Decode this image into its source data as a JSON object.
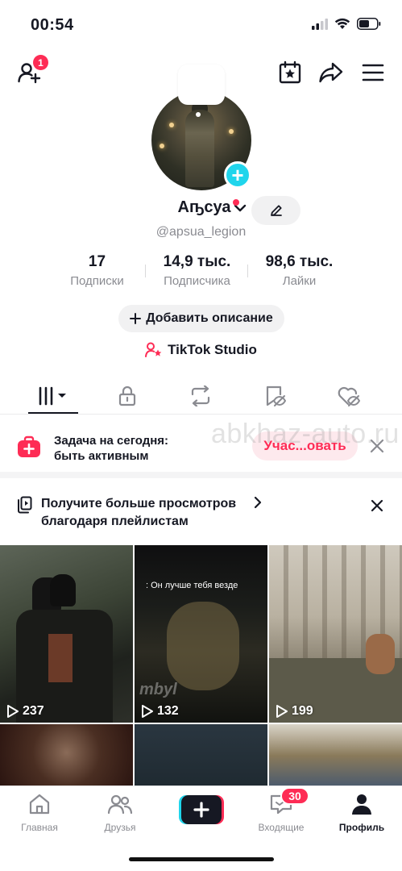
{
  "status_bar": {
    "time": "00:54"
  },
  "header": {
    "notification_count": "1"
  },
  "profile": {
    "display_name": "Аҧсуа",
    "username": "@apsua_legion",
    "stats": [
      {
        "value": "17",
        "label": "Подписки"
      },
      {
        "value": "14,9 тыс.",
        "label": "Подписчика"
      },
      {
        "value": "98,6 тыс.",
        "label": "Лайки"
      }
    ],
    "add_description_label": "Добавить описание",
    "studio_label": "TikTok Studio"
  },
  "task_card": {
    "line1": "Задача на сегодня:",
    "line2": "быть активным",
    "button_label": "Учас...овать"
  },
  "watermark": "abkhaz-auto.ru",
  "playlist_card": {
    "line1": "Получите больше просмотров",
    "line2": "благодаря плейлистам"
  },
  "videos": [
    {
      "views": "237"
    },
    {
      "views": "132",
      "caption": ": Он лучше тебя везде",
      "overlay": "mbyl"
    },
    {
      "views": "199"
    }
  ],
  "bottom_nav": {
    "home": "Главная",
    "friends": "Друзья",
    "inbox": "Входящие",
    "inbox_badge": "30",
    "profile": "Профиль"
  },
  "colors": {
    "accent": "#fe2c55",
    "cyan": "#20d5ec"
  }
}
